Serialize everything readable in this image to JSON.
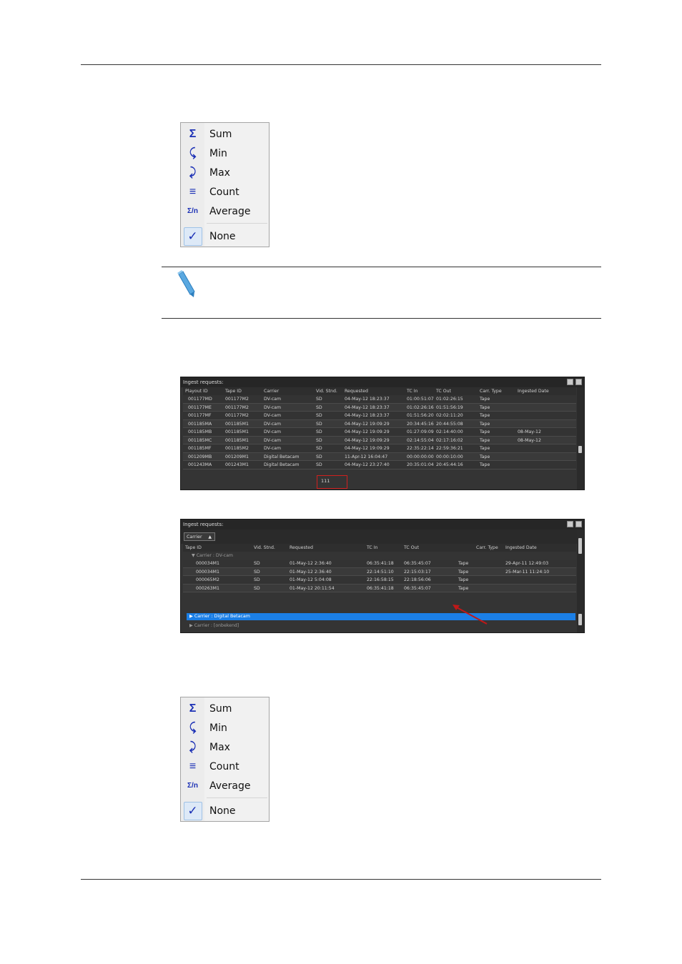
{
  "menu": {
    "items": [
      {
        "label": "Sum",
        "icon": "sigma-icon",
        "glyph": "Σ"
      },
      {
        "label": "Min",
        "icon": "min-icon",
        "glyph": "⤹"
      },
      {
        "label": "Max",
        "icon": "max-icon",
        "glyph": "⤸"
      },
      {
        "label": "Count",
        "icon": "count-icon",
        "glyph": "≡"
      },
      {
        "label": "Average",
        "icon": "average-icon",
        "glyph": "Σ/n"
      }
    ],
    "none": {
      "label": "None",
      "icon": "check-icon",
      "glyph": "✓"
    }
  },
  "grid1": {
    "title": "Ingest requests:",
    "columns": [
      "Playout ID",
      "Tape ID",
      "Carrier",
      "Vid. Stnd.",
      "Requested",
      "TC In",
      "TC Out",
      "Carr. Type",
      "Ingested Date"
    ],
    "rows": [
      [
        "001177MD",
        "001177M2",
        "DV-cam",
        "SD",
        "04-May-12 18:23:37",
        "01:00:51:07",
        "01:02:26:15",
        "Tape",
        ""
      ],
      [
        "001177ME",
        "001177M2",
        "DV-cam",
        "SD",
        "04-May-12 18:23:37",
        "01:02:26:16",
        "01:51:56:19",
        "Tape",
        ""
      ],
      [
        "001177MF",
        "001177M2",
        "DV-cam",
        "SD",
        "04-May-12 18:23:37",
        "01:51:56:20",
        "02:02:11:20",
        "Tape",
        ""
      ],
      [
        "001185MA",
        "001185M1",
        "DV-cam",
        "SD",
        "04-May-12 19:09:29",
        "20:34:45:16",
        "20:44:55:08",
        "Tape",
        ""
      ],
      [
        "001185MB",
        "001185M1",
        "DV-cam",
        "SD",
        "04-May-12 19:09:29",
        "01:27:09:09",
        "02:14:40:00",
        "Tape",
        "08-May-12"
      ],
      [
        "001185MC",
        "001185M1",
        "DV-cam",
        "SD",
        "04-May-12 19:09:29",
        "02:14:55:04",
        "02:17:16:02",
        "Tape",
        "08-May-12"
      ],
      [
        "001185MF",
        "001185M2",
        "DV-cam",
        "SD",
        "04-May-12 19:09:29",
        "22:35:22:14",
        "22:59:36:21",
        "Tape",
        ""
      ],
      [
        "001209MB",
        "001209M1",
        "Digital Betacam",
        "SD",
        "11-Apr-12 16:04:47",
        "00:00:00:00",
        "00:00:10:00",
        "Tape",
        ""
      ],
      [
        "001243MA",
        "001243M1",
        "Digital Betacam",
        "SD",
        "04-May-12 23:27:40",
        "20:35:01:04",
        "20:45:44:16",
        "Tape",
        ""
      ]
    ],
    "summary": "111"
  },
  "grid2": {
    "title": "Ingest requests:",
    "group_chip": "Carrier",
    "columns": [
      "Tape ID",
      "Vid. Stnd.",
      "Requested",
      "TC In",
      "TC Out",
      "Carr. Type",
      "Ingested Date"
    ],
    "group_open": "Carrier : DV-cam",
    "rows": [
      [
        "000034M1",
        "SD",
        "01-May-12 2:36:40",
        "06:35:41:18",
        "06:35:45:07",
        "Tape",
        "29-Apr-11 12:49:03"
      ],
      [
        "000034M1",
        "SD",
        "01-May-12 2:36:40",
        "22:14:51:10",
        "22:15:03:17",
        "Tape",
        "25-Mar-11 11:24:10"
      ],
      [
        "000065M2",
        "SD",
        "01-May-12 5:04:08",
        "22:16:58:15",
        "22:18:56:06",
        "Tape",
        ""
      ],
      [
        "000263M1",
        "SD",
        "01-May-12 20:11:54",
        "06:35:41:18",
        "06:35:45:07",
        "Tape",
        ""
      ]
    ],
    "group_selected": "Carrier : Digital Betacam",
    "group_other": "Carrier : [onbekend]"
  }
}
